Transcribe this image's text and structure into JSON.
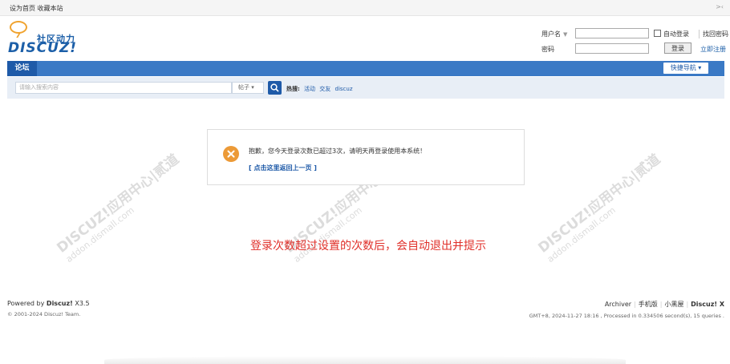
{
  "topbar": {
    "links": [
      "设为首页",
      "收藏本站"
    ],
    "collapse": ">‹"
  },
  "logo": {
    "cn": "社区动力",
    "en": "DISCUZ!"
  },
  "login": {
    "username_label": "用户名",
    "password_label": "密码",
    "auto_login": "自动登录",
    "find_password": "找回密码",
    "login_button": "登录",
    "register": "立即注册"
  },
  "nav": {
    "current": "论坛",
    "quick_nav": "快捷导航 ▾"
  },
  "search": {
    "placeholder": "请输入搜索内容",
    "type": "帖子",
    "hot_label": "热搜:",
    "hot_tags": [
      "活动",
      "交友",
      "discuz"
    ]
  },
  "message": {
    "text": "抱歉，您今天登录次数已超过3次，请明天再登录使用本系统！",
    "back_link": "[ 点击这里返回上一页 ]"
  },
  "watermark": {
    "main": "DISCUZ!应用中心|贰道",
    "sub": "addon.dismall.com"
  },
  "note": "登录次数超过设置的次数后，会自动退出并提示",
  "footer": {
    "powered_prefix": "Powered by ",
    "powered_brand": "Discuz!",
    "version": " X3.5",
    "copyright": "© 2001-2024 Discuz! Team.",
    "links": [
      "Archiver",
      "手机版",
      "小黑屋",
      "Discuz! X"
    ],
    "gmt": "GMT+8, 2024-11-27 18:16 , Processed in 0.334506 second(s), 15 queries ."
  }
}
